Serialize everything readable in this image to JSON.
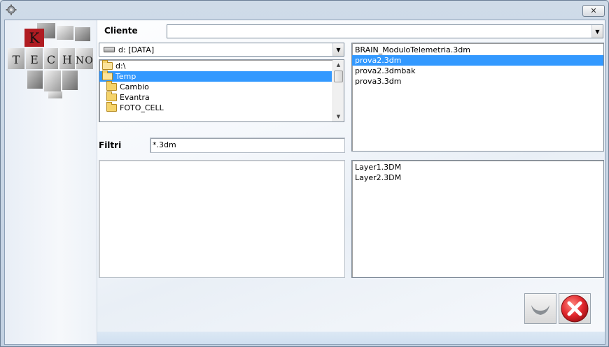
{
  "window": {
    "title": ""
  },
  "logo": {
    "letters": [
      "K",
      "T",
      "E",
      "C",
      "H",
      "N",
      "O"
    ]
  },
  "cliente": {
    "label": "Cliente",
    "value": ""
  },
  "drive": {
    "selected": "d: [DATA]"
  },
  "folders": [
    {
      "name": "d:\\",
      "state": "open",
      "selected": false
    },
    {
      "name": "Temp",
      "state": "open",
      "selected": true
    },
    {
      "name": "Cambio",
      "state": "closed",
      "selected": false
    },
    {
      "name": "Evantra",
      "state": "closed",
      "selected": false
    },
    {
      "name": "FOTO_CELL",
      "state": "closed",
      "selected": false
    }
  ],
  "files": [
    "BRAIN_ModuloTelemetria.3dm",
    "prova2.3dm",
    "prova2.3dmbak",
    "prova3.3dm"
  ],
  "files_selected_index": 1,
  "filtri": {
    "label": "Filtri",
    "value": "*.3dm"
  },
  "layers": [
    "Layer1.3DM",
    "Layer2.3DM"
  ],
  "colors": {
    "selection": "#3399ff",
    "cancel_red": "#d9262c"
  },
  "icons": {
    "window": "gear-icon",
    "close": "close-x-icon",
    "confirm": "confirm-icon",
    "cancel": "cancel-icon"
  }
}
